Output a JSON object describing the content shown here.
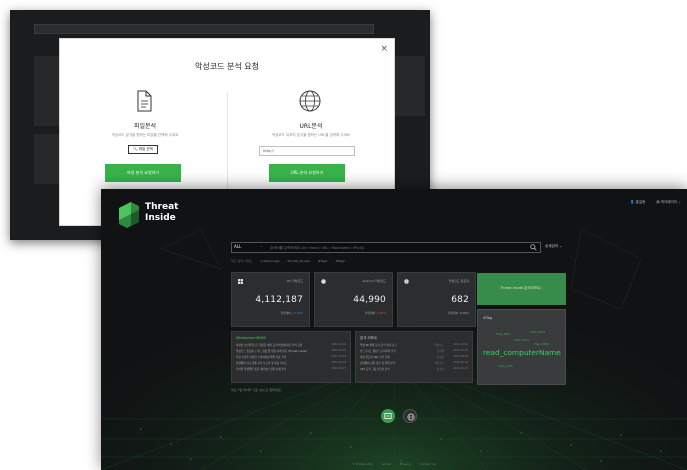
{
  "modal": {
    "title": "악성코드 분석 요청",
    "close": "×",
    "file": {
      "title": "파일분석",
      "desc": "악성코드 분석을 원하는 파일을 선택해 주세요",
      "select_btn": "🔍 파일 선택",
      "submit_btn": "파일 분석 요청하기"
    },
    "url": {
      "title": "URL분석",
      "desc": "악성코드 유포지 분석을 원하는 URL을 입력해 주세요",
      "input_value": "http://",
      "submit_btn": "URL 분석 요청하기"
    }
  },
  "dashboard": {
    "logo_line1": "Threat",
    "logo_line2": "Inside",
    "user": "홍길동",
    "mypage": "마이페이지",
    "search": {
      "scope": "ALL",
      "placeholder": "검색어를 입력하세요 (ex: Hash / URL / Hostname / IP(v4))",
      "advanced": "상세검색"
    },
    "recent": {
      "label": "최근 검색 키워드",
      "items": [
        "xxltvkim.apk",
        "Emotet_01.exe",
        "#Tag1",
        "#Tag2"
      ]
    },
    "stats": [
      {
        "label": "PC 악성코드",
        "value": "4,112,187",
        "delta": "전일대비 ",
        "delta_val": "+2.32%",
        "trend": "up"
      },
      {
        "label": "Android 악성코드",
        "value": "44,990",
        "delta": "전일대비 ",
        "delta_val": "-1.48%",
        "trend": "down"
      },
      {
        "label": "악성코드 유포지",
        "value": "682",
        "delta": "전일대비 ",
        "delta_val": "-0.02%",
        "trend": "flat"
      }
    ],
    "threat_card": "Threat Inside 분석리포트 ›",
    "ftag": {
      "title": "#Tag",
      "cloud": [
        "TAG_1801",
        "TAG_0004",
        "TAG_2021",
        "TAG_5556",
        "TAG_1105"
      ],
      "big": "read_computerName"
    },
    "list1": {
      "title": "Whatsnew NEWS",
      "rows": [
        {
          "text": "사내망 보안위협으로 위장한 해킹 공격 확산에 대한 주의 요망",
          "date": "2021.10.01"
        },
        {
          "text": "악성코드 유포를 노리는 정상 앱 위장 사례 증가 (Threat Inside)",
          "date": "2021.09.30"
        },
        {
          "text": "특정 기관을 사칭한 스피어피싱 메일 유포 주의",
          "date": "2021.09.29"
        },
        {
          "text": "랜섬웨어 신규 변종 분석 보고서 및 대응 가이드",
          "date": "2021.09.28"
        },
        {
          "text": "모바일 악성앱을 통한 개인정보 탈취 사례 분석",
          "date": "2021.09.27"
        }
      ]
    },
    "list2": {
      "title": "분석 리포트",
      "rows": [
        {
          "text": "악성 PE 파일 동적 분석 결과 보고",
          "tag": "악성코드",
          "date": "2021.10.01"
        },
        {
          "text": "안드로이드 뱅킹 트로이목마 분석",
          "tag": "모바일",
          "date": "2021.09.30"
        },
        {
          "text": "피싱 유포지 URL 분석 결과",
          "tag": "유포지",
          "date": "2021.09.29"
        },
        {
          "text": "랜섬웨어 감염 경로 및 행위 분석",
          "tag": "악성코드",
          "date": "2021.09.28"
        },
        {
          "text": "APT 공격 그룹 인프라 분석",
          "tag": "유포지",
          "date": "2021.09.27"
        }
      ]
    },
    "note": "최근 7일 데이터 기준 (실시간 업데이트)",
    "footer": [
      "© ESTsecurity",
      "About",
      "Privacy",
      "Contact Us"
    ]
  }
}
